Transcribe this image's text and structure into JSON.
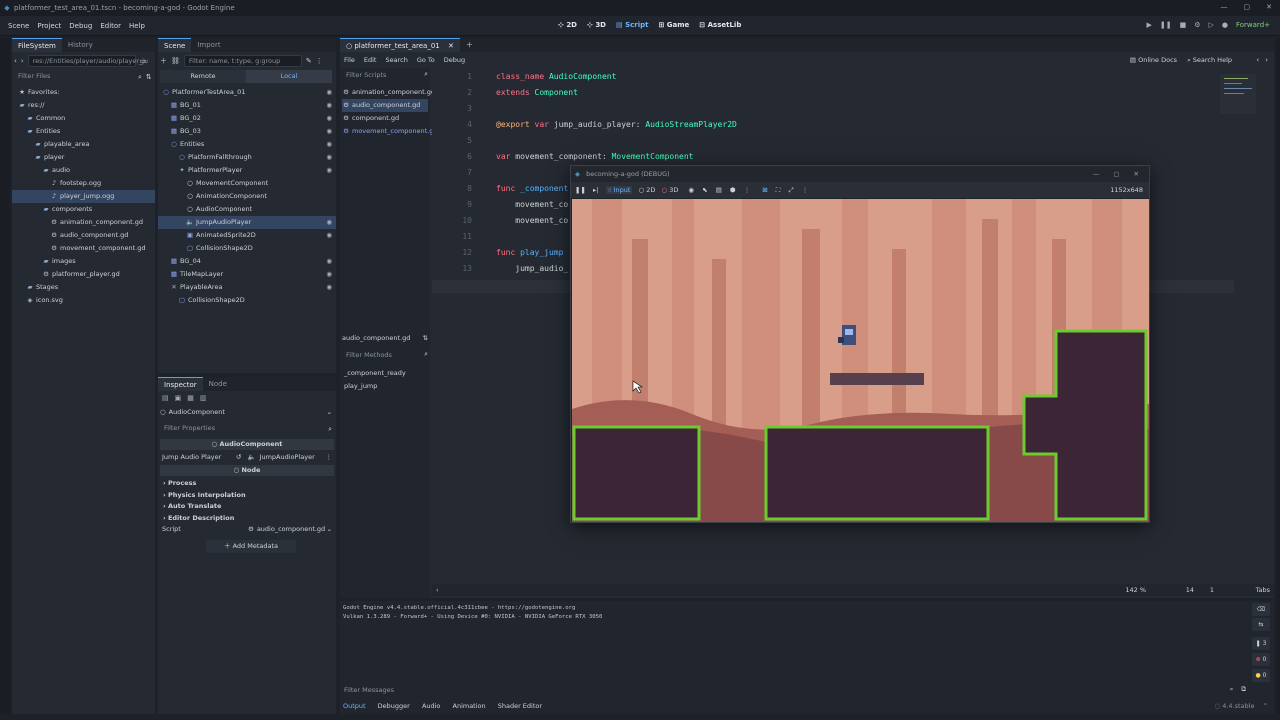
{
  "window": {
    "title": "platformer_test_area_01.tscn - becoming-a-god - Godot Engine"
  },
  "menu": {
    "items": [
      "Scene",
      "Project",
      "Debug",
      "Editor",
      "Help"
    ]
  },
  "workspaces": {
    "items": [
      "2D",
      "3D",
      "Script",
      "Game",
      "AssetLib"
    ],
    "active": "Script"
  },
  "renderer": {
    "label": "Forward+"
  },
  "filesystem": {
    "tabs": [
      "FileSystem",
      "History"
    ],
    "path": "res://Entities/player/audio/player_ju",
    "filter_placeholder": "Filter Files",
    "items": [
      {
        "label": "Favorites:",
        "icon": "star-icon",
        "indent": 0
      },
      {
        "label": "res://",
        "icon": "folder-icon",
        "indent": 0
      },
      {
        "label": "Common",
        "icon": "folder-icon",
        "indent": 1
      },
      {
        "label": "Entities",
        "icon": "folder-icon",
        "indent": 1
      },
      {
        "label": "playable_area",
        "icon": "folder-icon",
        "indent": 2
      },
      {
        "label": "player",
        "icon": "folder-icon",
        "indent": 2
      },
      {
        "label": "audio",
        "icon": "folder-icon",
        "indent": 3
      },
      {
        "label": "footstep.ogg",
        "icon": "audio-file-icon",
        "indent": 4
      },
      {
        "label": "player_jump.ogg",
        "icon": "audio-file-icon",
        "indent": 4,
        "selected": true
      },
      {
        "label": "components",
        "icon": "folder-icon",
        "indent": 3
      },
      {
        "label": "animation_component.gd",
        "icon": "script-icon",
        "indent": 4
      },
      {
        "label": "audio_component.gd",
        "icon": "script-icon",
        "indent": 4
      },
      {
        "label": "movement_component.gd",
        "icon": "script-icon",
        "indent": 4
      },
      {
        "label": "images",
        "icon": "folder-icon",
        "indent": 3
      },
      {
        "label": "platformer_player.gd",
        "icon": "script-icon",
        "indent": 3
      },
      {
        "label": "Stages",
        "icon": "folder-icon",
        "indent": 1
      },
      {
        "label": "icon.svg",
        "icon": "image-icon",
        "indent": 1
      }
    ]
  },
  "scene": {
    "tabs": [
      "Scene",
      "Import"
    ],
    "filter_placeholder": "Filter: name, t:type, g:group",
    "modes": [
      "Remote",
      "Local"
    ],
    "nodes": [
      {
        "label": "PlatformerTestArea_01",
        "icon": "node2d-icon",
        "indent": 0
      },
      {
        "label": "BG_01",
        "icon": "tilemap-icon",
        "indent": 1
      },
      {
        "label": "BG_02",
        "icon": "tilemap-icon",
        "indent": 1
      },
      {
        "label": "BG_03",
        "icon": "tilemap-icon",
        "indent": 1
      },
      {
        "label": "Entities",
        "icon": "node2d-icon",
        "indent": 1
      },
      {
        "label": "PlatformFallthrough",
        "icon": "node2d-icon",
        "indent": 2
      },
      {
        "label": "PlatformerPlayer",
        "icon": "character-icon",
        "indent": 2
      },
      {
        "label": "MovementComponent",
        "icon": "node-icon",
        "indent": 3
      },
      {
        "label": "AnimationComponent",
        "icon": "node-icon",
        "indent": 3
      },
      {
        "label": "AudioComponent",
        "icon": "node-icon",
        "indent": 3
      },
      {
        "label": "JumpAudioPlayer",
        "icon": "audio-player-icon",
        "indent": 3,
        "selected": true
      },
      {
        "label": "AnimatedSprite2D",
        "icon": "sprite-icon",
        "indent": 3
      },
      {
        "label": "CollisionShape2D",
        "icon": "collision-icon",
        "indent": 3
      },
      {
        "label": "BG_04",
        "icon": "tilemap-icon",
        "indent": 1
      },
      {
        "label": "TileMapLayer",
        "icon": "tilemap-icon",
        "indent": 1
      },
      {
        "label": "PlayableArea",
        "icon": "area-icon",
        "indent": 1
      },
      {
        "label": "CollisionShape2D",
        "icon": "collision-icon",
        "indent": 2
      }
    ]
  },
  "inspector": {
    "tabs": [
      "Inspector",
      "Node"
    ],
    "object": "AudioComponent",
    "filter_placeholder": "Filter Properties",
    "section": "AudioComponent",
    "prop_label": "Jump Audio Player",
    "prop_value": "JumpAudioPlayer",
    "node_section": "Node",
    "groups": [
      "Process",
      "Physics Interpolation",
      "Auto Translate",
      "Editor Description"
    ],
    "script_label": "Script",
    "script_value": "audio_component.gd",
    "add_metadata": "Add Metadata"
  },
  "script_editor": {
    "tab": "platformer_test_area_01",
    "menu": [
      "File",
      "Edit",
      "Search",
      "Go To",
      "Debug"
    ],
    "filter_scripts": "Filter Scripts",
    "scripts": [
      "animation_component.gd",
      "audio_component.gd",
      "component.gd",
      "movement_component.gd"
    ],
    "current_script": "audio_component.gd",
    "filter_methods": "Filter Methods",
    "methods": [
      "_component_ready",
      "play_jump"
    ],
    "help": [
      "Online Docs",
      "Search Help"
    ],
    "status": {
      "zoom": "142 %",
      "line": "14",
      "col": "1",
      "indent": "Tabs"
    }
  },
  "code_lines": [
    {
      "n": "1",
      "parts": [
        [
          "kw",
          "class_name "
        ],
        [
          "ty",
          "AudioComponent"
        ]
      ]
    },
    {
      "n": "2",
      "parts": [
        [
          "kw",
          "extends "
        ],
        [
          "ty",
          "Component"
        ]
      ]
    },
    {
      "n": "3",
      "parts": []
    },
    {
      "n": "4",
      "parts": [
        [
          "an",
          "@export "
        ],
        [
          "kw",
          "var "
        ],
        [
          "id",
          "jump_audio_player: "
        ],
        [
          "ty",
          "AudioStreamPlayer2D"
        ]
      ]
    },
    {
      "n": "5",
      "parts": []
    },
    {
      "n": "6",
      "parts": [
        [
          "kw",
          "var "
        ],
        [
          "id",
          "movement_component: "
        ],
        [
          "ty",
          "MovementComponent"
        ]
      ]
    },
    {
      "n": "7",
      "parts": []
    },
    {
      "n": "8",
      "parts": [
        [
          "kw",
          "func "
        ],
        [
          "fn",
          "_component"
        ]
      ]
    },
    {
      "n": "9",
      "parts": [
        [
          "id",
          "    movement_co"
        ]
      ]
    },
    {
      "n": "10",
      "parts": [
        [
          "id",
          "    movement_co"
        ]
      ]
    },
    {
      "n": "11",
      "parts": []
    },
    {
      "n": "12",
      "parts": [
        [
          "kw",
          "func "
        ],
        [
          "fn",
          "play_jump"
        ]
      ]
    },
    {
      "n": "13",
      "parts": [
        [
          "id",
          "    jump_audio_"
        ]
      ]
    },
    {
      "n": "14",
      "parts": []
    }
  ],
  "game_window": {
    "title": "becoming-a-god (DEBUG)",
    "toolbar": [
      "Input",
      "2D",
      "3D"
    ],
    "resolution": "1152x648"
  },
  "output": {
    "lines": [
      "Godot Engine v4.4.stable.official.4c311cbee - https://godotengine.org",
      "Vulkan 1.3.289 - Forward+ - Using Device #0: NVIDIA - NVIDIA GeForce RTX 3050"
    ],
    "filter_placeholder": "Filter Messages",
    "tabs": [
      "Output",
      "Debugger",
      "Audio",
      "Animation",
      "Shader Editor"
    ],
    "version": "4.4.stable",
    "counts": [
      "3",
      "0",
      "0"
    ]
  },
  "colors": {
    "accent": "#5aa0f0",
    "selection": "#344562",
    "sky": "#d79a84",
    "grass": "#6ecb2f",
    "dirt": "#3a2635"
  }
}
